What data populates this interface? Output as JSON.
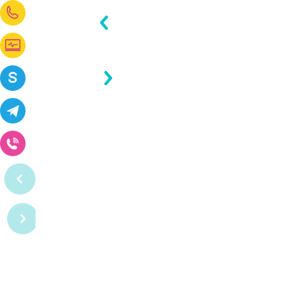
{
  "contacts": {
    "items": [
      {
        "icon": "phone-icon",
        "color": "#fcd21c"
      },
      {
        "icon": "monitor-icon",
        "color": "#fcd21c"
      },
      {
        "icon": "skype-icon",
        "color": "#1fa3e0"
      },
      {
        "icon": "telegram-icon",
        "color": "#20a4e2"
      },
      {
        "icon": "viber-icon",
        "color": "#e8469b"
      }
    ]
  },
  "navigation": {
    "prev_icon": "chevron-left-icon",
    "next_icon": "chevron-right-icon",
    "accent": "#00c0c8"
  },
  "side_controls": {
    "prev_icon": "chevron-left-icon",
    "next_icon": "chevron-right-icon",
    "background": "#b4e9ec"
  }
}
